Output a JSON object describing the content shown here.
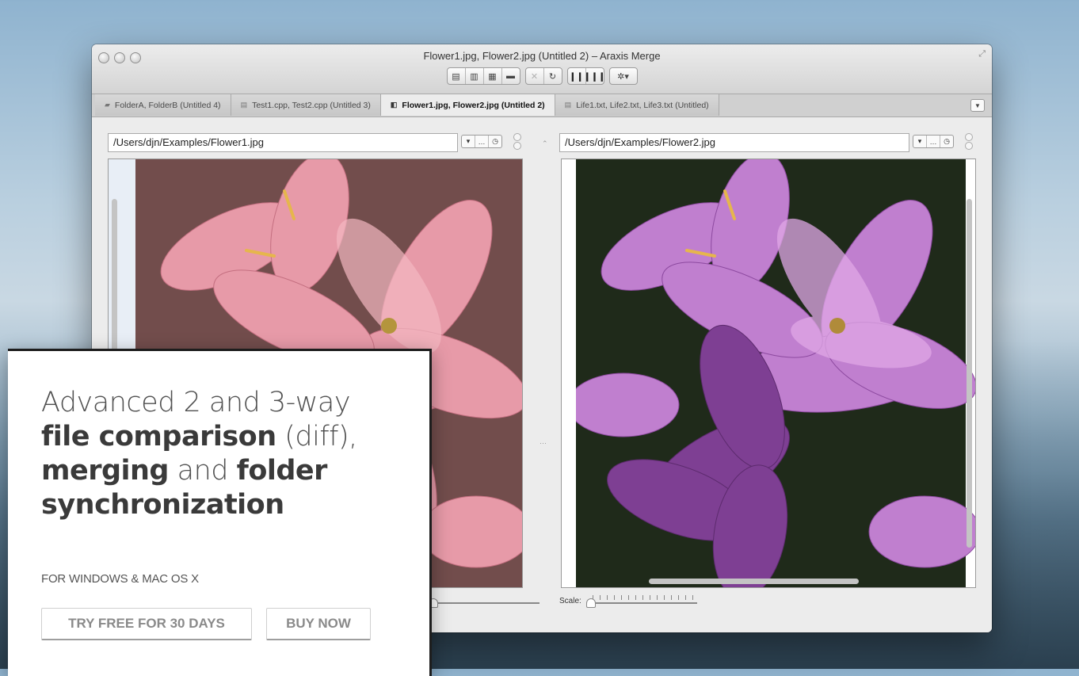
{
  "window": {
    "title": "Flower1.jpg, Flower2.jpg (Untitled 2) – Araxis Merge"
  },
  "toolbar": {
    "groups": [
      [
        "new-file-compare-icon",
        "new-text-compare-icon",
        "new-image-compare-icon",
        "new-folder-compare-icon"
      ],
      [
        "close-icon",
        "refresh-icon"
      ],
      [
        "two-way-icon",
        "three-way-icon"
      ],
      [
        "gear-menu-icon"
      ]
    ]
  },
  "tabs": [
    {
      "label": "FolderA, FolderB (Untitled 4)",
      "icon": "folder-icon",
      "active": false
    },
    {
      "label": "Test1.cpp, Test2.cpp (Untitled 3)",
      "icon": "document-icon",
      "active": false
    },
    {
      "label": "Flower1.jpg, Flower2.jpg (Untitled 2)",
      "icon": "image-compare-icon",
      "active": true
    },
    {
      "label": "Life1.txt, Life2.txt, Life3.txt (Untitled)",
      "icon": "document-icon",
      "active": false
    }
  ],
  "panes": {
    "left": {
      "path": "/Users/djn/Examples/Flower1.jpg",
      "tint": "#e89aa8"
    },
    "right": {
      "path": "/Users/djn/Examples/Flower2.jpg",
      "tint": "#9b4fb0"
    }
  },
  "scale": {
    "label": "Scale:"
  },
  "promo": {
    "line1": "Advanced 2 and 3-way",
    "bold1": "file comparison",
    "rest1": " (diff),",
    "bold2": "merging",
    "rest2": " and ",
    "bold3": "folder",
    "bold4": "synchronization",
    "platform": "FOR WINDOWS & MAC OS X",
    "try_label": "TRY FREE FOR 30 DAYS",
    "buy_label": "BUY NOW"
  }
}
